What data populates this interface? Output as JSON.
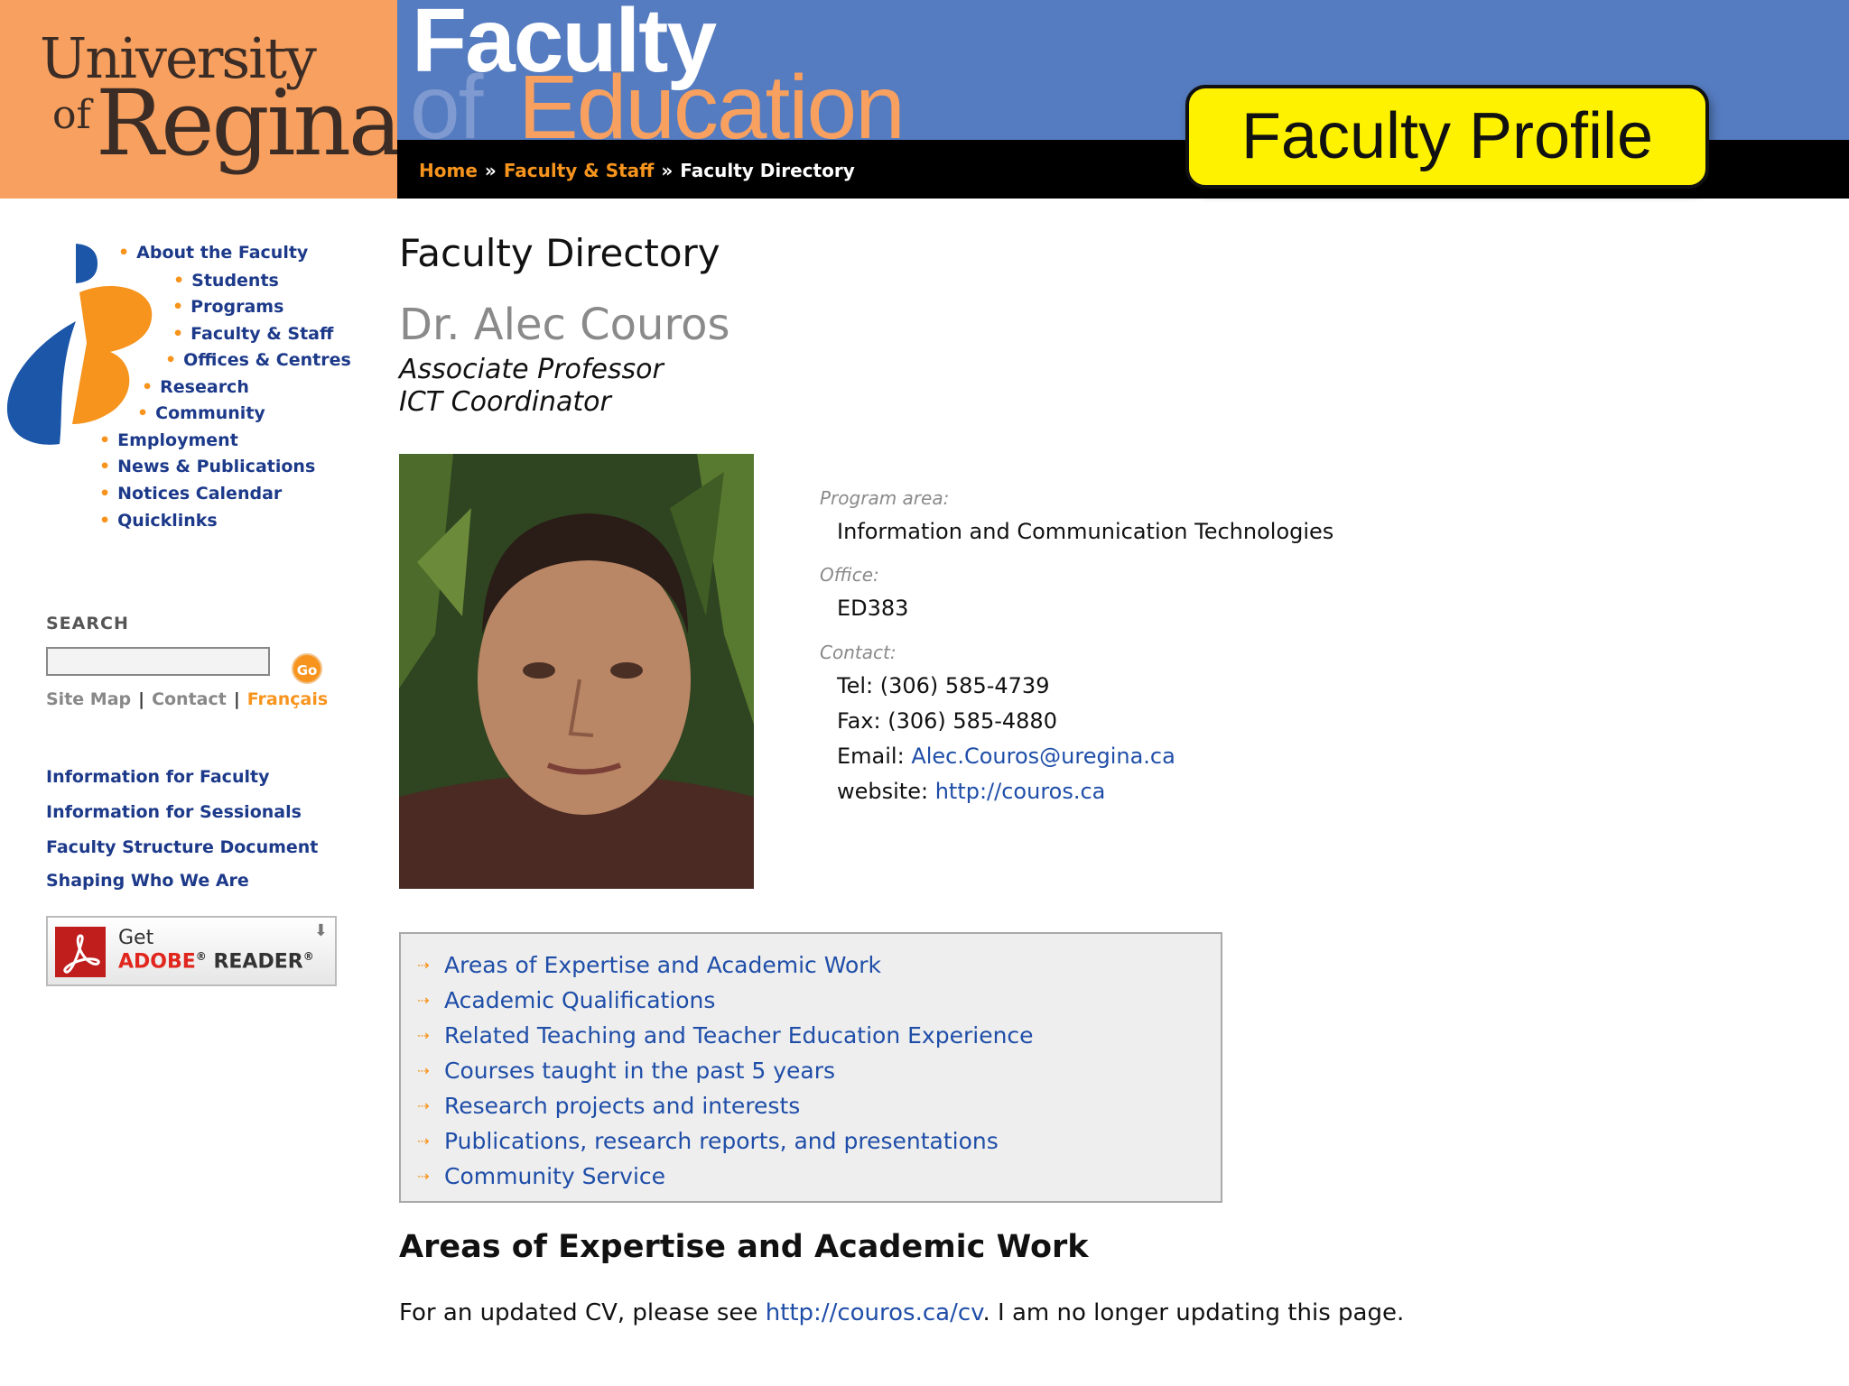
{
  "header": {
    "logo_university": "University",
    "logo_of": "of",
    "logo_regina": "Regina",
    "banner_faculty": "Faculty",
    "banner_of": "of",
    "banner_education": "Education",
    "breadcrumb": {
      "home": "Home",
      "faculty_staff": "Faculty & Staff",
      "current": "Faculty Directory",
      "separator": "»"
    },
    "overlay_badge": "Faculty Profile"
  },
  "sidebar": {
    "nav_items": [
      "About the Faculty",
      "Students",
      "Programs",
      "Faculty & Staff",
      "Offices & Centres",
      "Research",
      "Community",
      "Employment",
      "News & Publications",
      "Notices Calendar",
      "Quicklinks"
    ],
    "search": {
      "label": "SEARCH",
      "value": "",
      "go_label": "Go"
    },
    "util_links": {
      "site_map": "Site Map",
      "contact": "Contact",
      "francais": "Français",
      "separator": "|"
    },
    "links": [
      "Information for Faculty",
      "Information for Sessionals",
      "Faculty Structure Document",
      "Shaping Who We Are"
    ],
    "adobe": {
      "get": "Get",
      "brand": "ADOBE",
      "reg": "®",
      "reader": " READER",
      "reg2": "®"
    }
  },
  "main": {
    "page_title": "Faculty Directory",
    "name": "Dr. Alec Couros",
    "roles": [
      "Associate Professor",
      "ICT Coordinator"
    ],
    "program_area_label": "Program area:",
    "program_area": "Information and Communication Technologies",
    "office_label": "Office:",
    "office": "ED383",
    "contact_label": "Contact:",
    "tel_label": "Tel:",
    "tel": "(306) 585-4739",
    "fax_label": "Fax:",
    "fax": "(306) 585-4880",
    "email_label": "Email:",
    "email": "Alec.Couros@uregina.ca",
    "website_label": "website:",
    "website": "http://couros.ca",
    "toc": [
      "Areas of Expertise and Academic Work",
      "Academic Qualifications",
      "Related Teaching and Teacher Education Experience",
      "Courses taught in the past 5 years",
      "Research projects and interests",
      "Publications, research reports, and presentations",
      "Community Service"
    ],
    "section_heading": "Areas of Expertise and Academic Work",
    "section_text_before": "For an updated CV, please see ",
    "section_link": "http://couros.ca/cv",
    "section_text_after": ". I am no longer updating this page."
  },
  "colors": {
    "orange": "#f7a05f",
    "accent_orange": "#f7941d",
    "banner_blue": "#557cc0",
    "nav_blue": "#1d3a8a",
    "link_blue": "#1f4ea8",
    "badge_yellow": "#fff200"
  },
  "icons": {
    "toc_bullet": "dotted-arrow-icon",
    "adobe": "adobe-reader-icon",
    "download": "download-arrow-icon"
  }
}
